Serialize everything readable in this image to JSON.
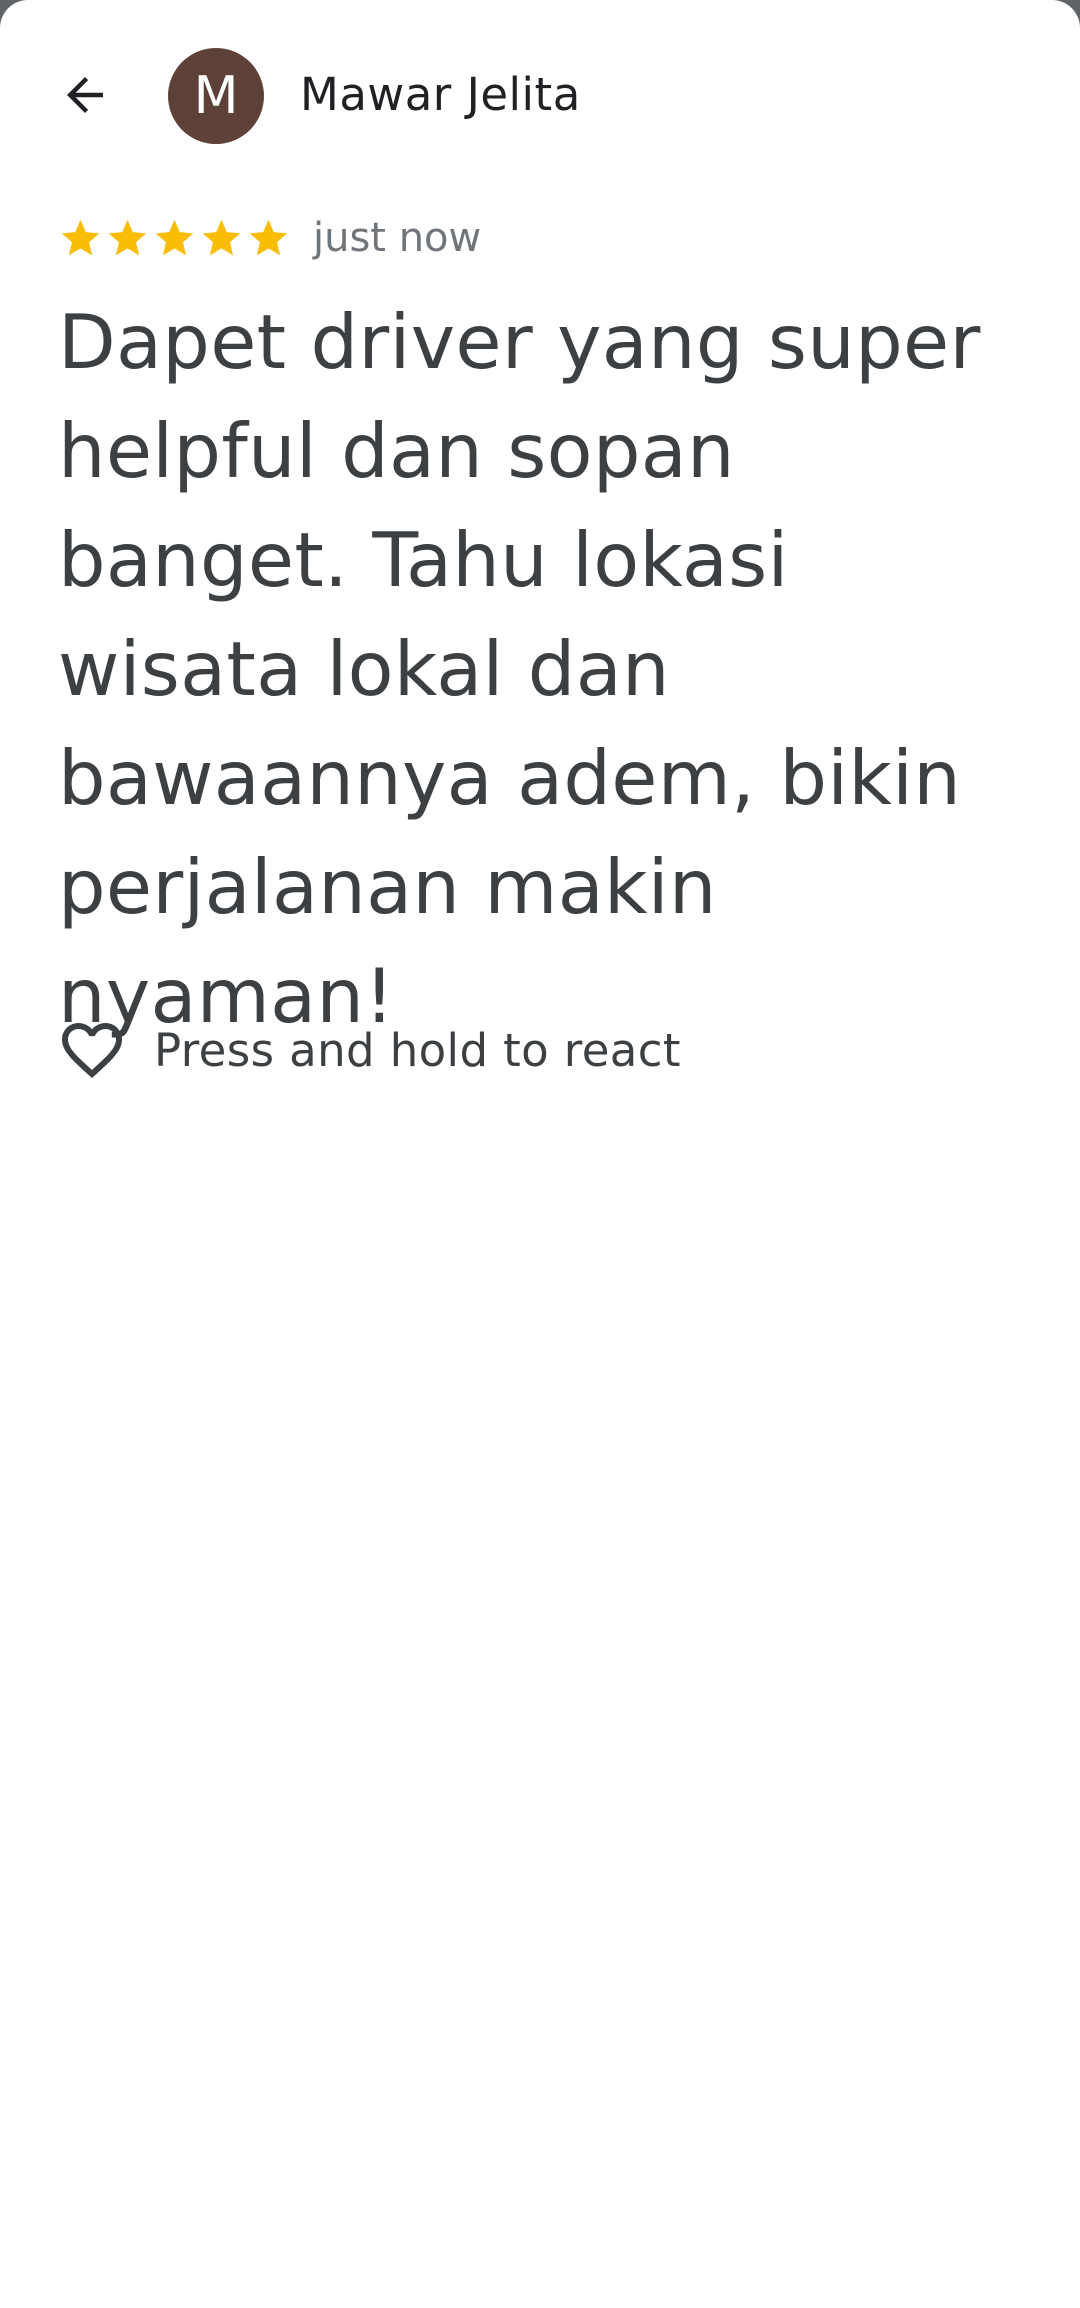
{
  "header": {
    "back_icon": "arrow-back-icon",
    "avatar_initial": "M",
    "avatar_color": "#5d4037",
    "author_name": "Mawar Jelita"
  },
  "review": {
    "rating": 5,
    "rating_max": 5,
    "star_color": "#fbbc04",
    "timestamp": "just now",
    "text": "Dapet driver yang super helpful dan sopan banget. Tahu lokasi wisata lokal dan bawaannya adem, bikin perjalanan makin nyaman!"
  },
  "reaction": {
    "icon": "heart-outline-icon",
    "label": "Press and hold to react"
  }
}
